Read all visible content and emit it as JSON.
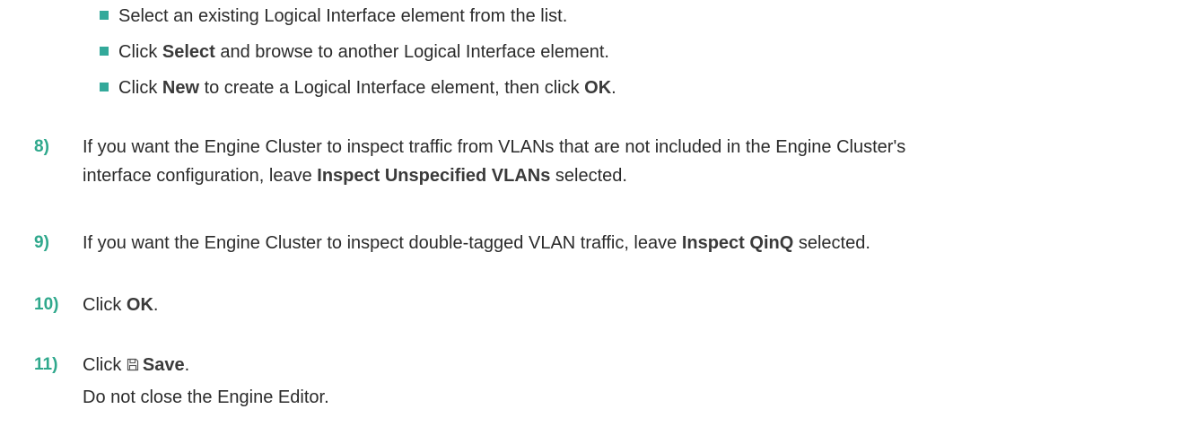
{
  "bullets": [
    {
      "parts": [
        "Select an existing Logical Interface element from the list."
      ]
    },
    {
      "p1": "Click ",
      "b1": "Select",
      "p2": " and browse to another Logical Interface element."
    },
    {
      "p1": "Click ",
      "b1": "New",
      "p2": " to create a Logical Interface element, then click ",
      "b2": "OK",
      "p3": "."
    }
  ],
  "steps": {
    "s8": {
      "num": "8)",
      "line1": "If you want the Engine Cluster to inspect traffic from VLANs that are not included in the Engine Cluster's",
      "line2_pre": "interface configuration, leave ",
      "line2_bold": "Inspect Unspecified VLANs",
      "line2_post": " selected."
    },
    "s9": {
      "num": "9)",
      "pre": "If you want the Engine Cluster to inspect double-tagged VLAN traffic, leave ",
      "bold": "Inspect QinQ",
      "post": " selected."
    },
    "s10": {
      "num": "10)",
      "pre": "Click ",
      "bold": "OK",
      "post": "."
    },
    "s11": {
      "num": "11)",
      "pre": "Click ",
      "icon": "save-icon",
      "bold": "Save",
      "post": ".",
      "line2": "Do not close the Engine Editor."
    }
  },
  "colors": {
    "accent": "#2fa88c",
    "text": "#2b2b2b"
  }
}
